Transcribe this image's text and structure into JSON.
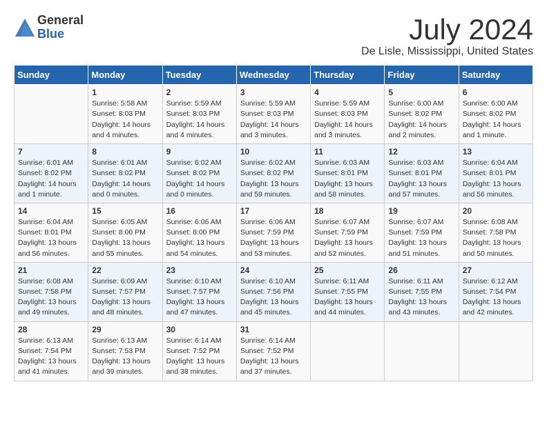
{
  "header": {
    "logo_general": "General",
    "logo_blue": "Blue",
    "title": "July 2024",
    "location": "De Lisle, Mississippi, United States"
  },
  "calendar": {
    "days_of_week": [
      "Sunday",
      "Monday",
      "Tuesday",
      "Wednesday",
      "Thursday",
      "Friday",
      "Saturday"
    ],
    "weeks": [
      [
        {
          "day": "",
          "info": ""
        },
        {
          "day": "1",
          "info": "Sunrise: 5:58 AM\nSunset: 8:03 PM\nDaylight: 14 hours\nand 4 minutes."
        },
        {
          "day": "2",
          "info": "Sunrise: 5:59 AM\nSunset: 8:03 PM\nDaylight: 14 hours\nand 4 minutes."
        },
        {
          "day": "3",
          "info": "Sunrise: 5:59 AM\nSunset: 8:03 PM\nDaylight: 14 hours\nand 3 minutes."
        },
        {
          "day": "4",
          "info": "Sunrise: 5:59 AM\nSunset: 8:03 PM\nDaylight: 14 hours\nand 3 minutes."
        },
        {
          "day": "5",
          "info": "Sunrise: 6:00 AM\nSunset: 8:02 PM\nDaylight: 14 hours\nand 2 minutes."
        },
        {
          "day": "6",
          "info": "Sunrise: 6:00 AM\nSunset: 8:02 PM\nDaylight: 14 hours\nand 1 minute."
        }
      ],
      [
        {
          "day": "7",
          "info": "Sunrise: 6:01 AM\nSunset: 8:02 PM\nDaylight: 14 hours\nand 1 minute."
        },
        {
          "day": "8",
          "info": "Sunrise: 6:01 AM\nSunset: 8:02 PM\nDaylight: 14 hours\nand 0 minutes."
        },
        {
          "day": "9",
          "info": "Sunrise: 6:02 AM\nSunset: 8:02 PM\nDaylight: 14 hours\nand 0 minutes."
        },
        {
          "day": "10",
          "info": "Sunrise: 6:02 AM\nSunset: 8:02 PM\nDaylight: 13 hours\nand 59 minutes."
        },
        {
          "day": "11",
          "info": "Sunrise: 6:03 AM\nSunset: 8:01 PM\nDaylight: 13 hours\nand 58 minutes."
        },
        {
          "day": "12",
          "info": "Sunrise: 6:03 AM\nSunset: 8:01 PM\nDaylight: 13 hours\nand 57 minutes."
        },
        {
          "day": "13",
          "info": "Sunrise: 6:04 AM\nSunset: 8:01 PM\nDaylight: 13 hours\nand 56 minutes."
        }
      ],
      [
        {
          "day": "14",
          "info": "Sunrise: 6:04 AM\nSunset: 8:01 PM\nDaylight: 13 hours\nand 56 minutes."
        },
        {
          "day": "15",
          "info": "Sunrise: 6:05 AM\nSunset: 8:00 PM\nDaylight: 13 hours\nand 55 minutes."
        },
        {
          "day": "16",
          "info": "Sunrise: 6:06 AM\nSunset: 8:00 PM\nDaylight: 13 hours\nand 54 minutes."
        },
        {
          "day": "17",
          "info": "Sunrise: 6:06 AM\nSunset: 7:59 PM\nDaylight: 13 hours\nand 53 minutes."
        },
        {
          "day": "18",
          "info": "Sunrise: 6:07 AM\nSunset: 7:59 PM\nDaylight: 13 hours\nand 52 minutes."
        },
        {
          "day": "19",
          "info": "Sunrise: 6:07 AM\nSunset: 7:59 PM\nDaylight: 13 hours\nand 51 minutes."
        },
        {
          "day": "20",
          "info": "Sunrise: 6:08 AM\nSunset: 7:58 PM\nDaylight: 13 hours\nand 50 minutes."
        }
      ],
      [
        {
          "day": "21",
          "info": "Sunrise: 6:08 AM\nSunset: 7:58 PM\nDaylight: 13 hours\nand 49 minutes."
        },
        {
          "day": "22",
          "info": "Sunrise: 6:09 AM\nSunset: 7:57 PM\nDaylight: 13 hours\nand 48 minutes."
        },
        {
          "day": "23",
          "info": "Sunrise: 6:10 AM\nSunset: 7:57 PM\nDaylight: 13 hours\nand 47 minutes."
        },
        {
          "day": "24",
          "info": "Sunrise: 6:10 AM\nSunset: 7:56 PM\nDaylight: 13 hours\nand 45 minutes."
        },
        {
          "day": "25",
          "info": "Sunrise: 6:11 AM\nSunset: 7:55 PM\nDaylight: 13 hours\nand 44 minutes."
        },
        {
          "day": "26",
          "info": "Sunrise: 6:11 AM\nSunset: 7:55 PM\nDaylight: 13 hours\nand 43 minutes."
        },
        {
          "day": "27",
          "info": "Sunrise: 6:12 AM\nSunset: 7:54 PM\nDaylight: 13 hours\nand 42 minutes."
        }
      ],
      [
        {
          "day": "28",
          "info": "Sunrise: 6:13 AM\nSunset: 7:54 PM\nDaylight: 13 hours\nand 41 minutes."
        },
        {
          "day": "29",
          "info": "Sunrise: 6:13 AM\nSunset: 7:53 PM\nDaylight: 13 hours\nand 39 minutes."
        },
        {
          "day": "30",
          "info": "Sunrise: 6:14 AM\nSunset: 7:52 PM\nDaylight: 13 hours\nand 38 minutes."
        },
        {
          "day": "31",
          "info": "Sunrise: 6:14 AM\nSunset: 7:52 PM\nDaylight: 13 hours\nand 37 minutes."
        },
        {
          "day": "",
          "info": ""
        },
        {
          "day": "",
          "info": ""
        },
        {
          "day": "",
          "info": ""
        }
      ]
    ]
  }
}
